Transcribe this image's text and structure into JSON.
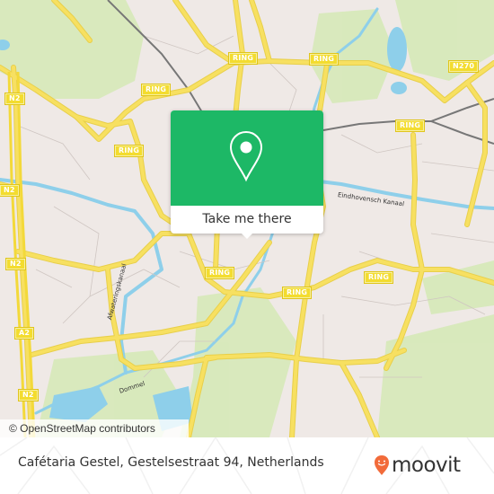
{
  "map": {
    "road_labels": [
      {
        "id": "ring-1",
        "text": "RING"
      },
      {
        "id": "ring-2",
        "text": "RING"
      },
      {
        "id": "ring-3",
        "text": "RING"
      },
      {
        "id": "ring-4",
        "text": "RING"
      },
      {
        "id": "ring-5",
        "text": "RING"
      },
      {
        "id": "ring-6",
        "text": "RING"
      },
      {
        "id": "ring-7",
        "text": "RING"
      },
      {
        "id": "ring-8",
        "text": "RING"
      },
      {
        "id": "n2-1",
        "text": "N2"
      },
      {
        "id": "n2-2",
        "text": "N2"
      },
      {
        "id": "n2-3",
        "text": "N2"
      },
      {
        "id": "n2-4",
        "text": "N2"
      },
      {
        "id": "n2-5",
        "text": "N2"
      },
      {
        "id": "a2-1",
        "text": "A2"
      },
      {
        "id": "n270",
        "text": "N270"
      }
    ],
    "water_labels": {
      "canal_east": "Eindhovensch Kanaal",
      "canal_west": "Afwateringskanaal",
      "river": "Dommel"
    },
    "attribution": "© OpenStreetMap contributors",
    "colors": {
      "land": "#efe9e6",
      "park": "#d5e8b5",
      "water": "#8ecfea",
      "road": "#f7e061",
      "rail": "#777777"
    }
  },
  "popup": {
    "icon": "map-pin-icon",
    "action_label": "Take me there",
    "accent_color": "#1db866"
  },
  "footer": {
    "address": "Cafétaria Gestel, Gestelsestraat 94, Netherlands",
    "brand": "moovit",
    "brand_icon": "moovit-smiley-pin-icon",
    "brand_color": "#f26b3a"
  }
}
